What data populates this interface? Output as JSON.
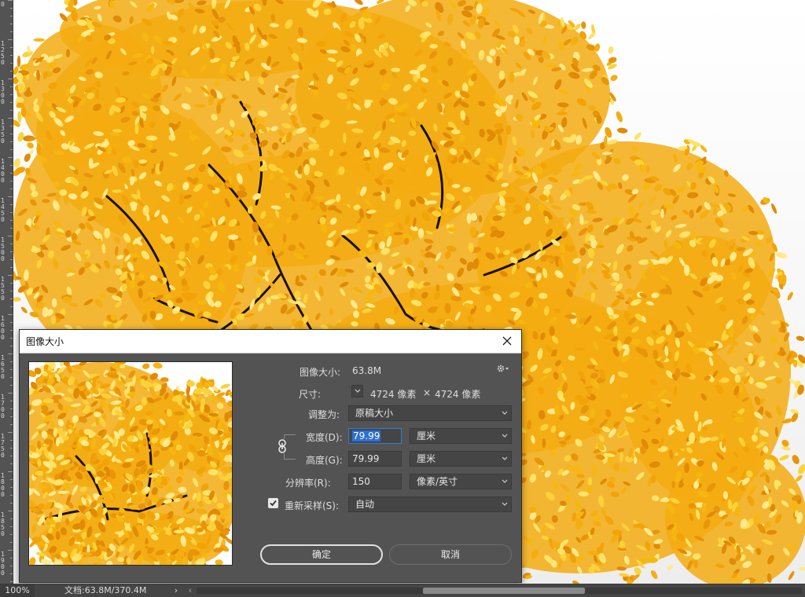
{
  "dialog": {
    "title": "图像大小",
    "image_size_label": "图像大小:",
    "image_size_value": "63.8M",
    "dimensions_label": "尺寸:",
    "dimensions_width": "4724 像素",
    "dimensions_sep": "×",
    "dimensions_height": "4724 像素",
    "fit_to_label": "调整为:",
    "fit_to_value": "原稿大小",
    "width_label": "宽度(D):",
    "width_value": "79.99",
    "width_unit": "厘米",
    "height_label": "高度(G):",
    "height_value": "79.99",
    "height_unit": "厘米",
    "resolution_label": "分辨率(R):",
    "resolution_value": "150",
    "resolution_unit": "像素/英寸",
    "resample_label": "重新采样(S):",
    "resample_checked": true,
    "resample_value": "自动",
    "ok_label": "确定",
    "cancel_label": "取消"
  },
  "statusbar": {
    "zoom": "100%",
    "doc_info": "文档:63.8M/370.4M",
    "arrow": "›",
    "scroll_left": "‹"
  },
  "ruler": {
    "labels": [
      "0",
      "1250",
      "1300",
      "1350",
      "1400",
      "1450",
      "1500",
      "1550",
      "1600",
      "1650",
      "1700",
      "1750",
      "1800",
      "1850",
      "1900"
    ]
  },
  "colors": {
    "dialog_bg": "#535353",
    "field_bg": "#454545",
    "accent_focus": "#2f7fd6",
    "foliage_yellow": "#f5b414"
  }
}
